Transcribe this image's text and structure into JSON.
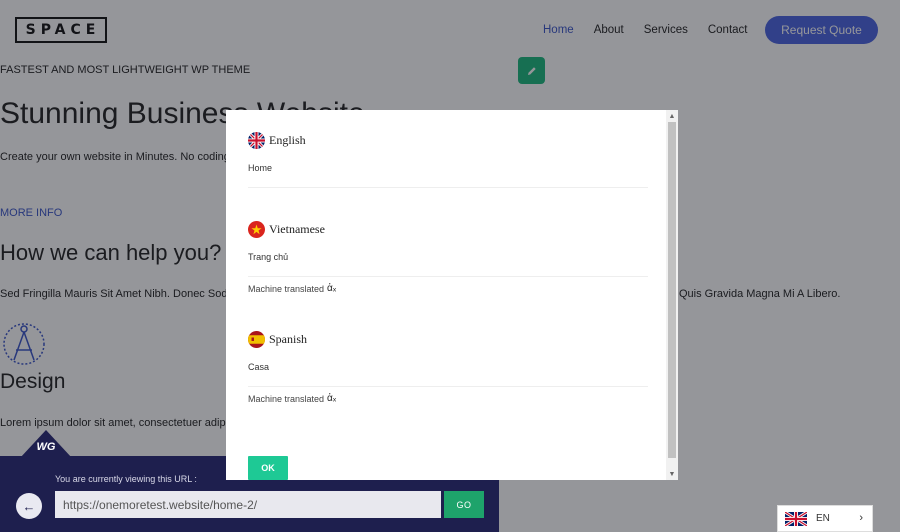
{
  "site": {
    "logo": "SPACE",
    "nav": [
      "Home",
      "About",
      "Services",
      "Contact"
    ],
    "quote_button": "Request Quote",
    "tagline": "FASTEST AND MOST LIGHTWEIGHT WP THEME",
    "hero_title": "Stunning Business Website",
    "hero_subtitle": "Create your own website in Minutes. No coding",
    "more_info": "MORE INFO",
    "help_title": "How we can help you?",
    "lorem_left": "Sed Fringilla Mauris Sit Amet Nibh. Donec Sod",
    "lorem_right": "Quis Gravida Magna Mi A Libero.",
    "design_title": "Design",
    "design_text": "Lorem ipsum dolor sit amet, consectetuer adip"
  },
  "modal": {
    "languages": [
      {
        "name": "English",
        "value": "Home",
        "flag": "uk-flag-icon"
      },
      {
        "name": "Vietnamese",
        "value": "Trang chủ",
        "note": "Machine translated",
        "flag": "vietnam-flag-icon"
      },
      {
        "name": "Spanish",
        "value": "Casa",
        "note": "Machine translated",
        "flag": "spain-flag-icon"
      }
    ],
    "ok_label": "OK"
  },
  "url_bar": {
    "caption": "You are currently viewing this URL :",
    "url": "https://onemoretest.website/home-2/",
    "go_label": "GO",
    "badge": "WG"
  },
  "language_switcher": {
    "current": "EN",
    "flag": "uk-flag-icon"
  },
  "colors": {
    "accent_blue": "#4a63e0",
    "ok_green": "#1ec995",
    "go_green": "#1ea36b",
    "url_panel": "#1e1f4e"
  }
}
